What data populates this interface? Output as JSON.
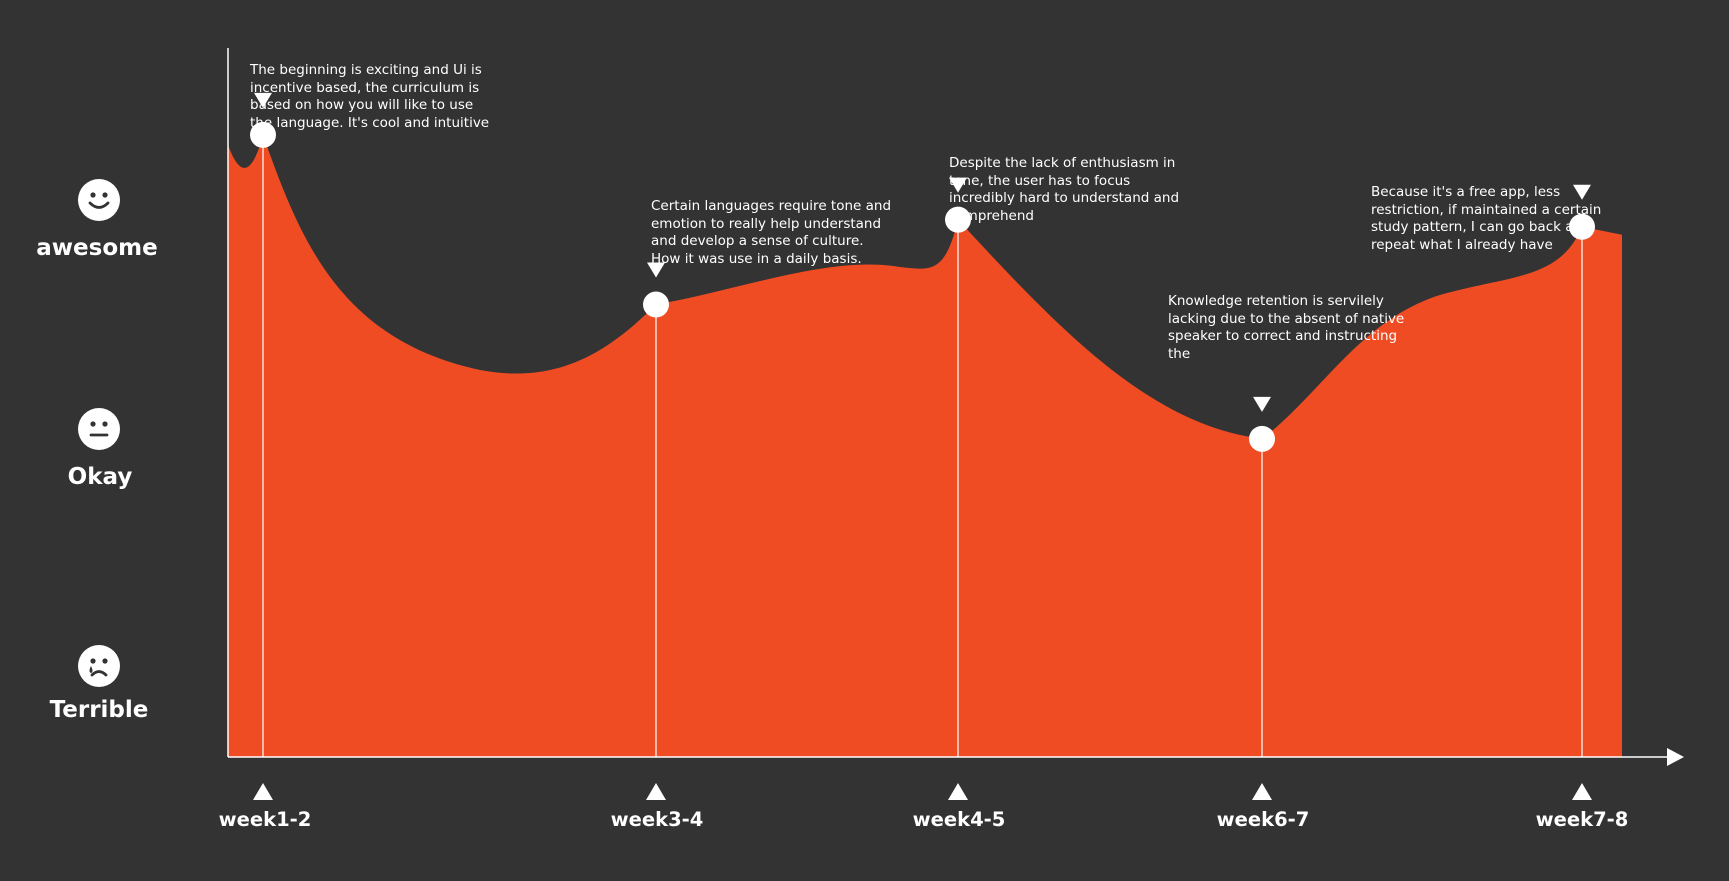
{
  "colors": {
    "background": "#333333",
    "area": "#F04C23",
    "foreground": "#FFFFFF"
  },
  "y_levels": [
    {
      "label": "awesome",
      "icon": "smile-face-icon"
    },
    {
      "label": "Okay",
      "icon": "neutral-face-icon"
    },
    {
      "label": "Terrible",
      "icon": "crying-face-icon"
    }
  ],
  "chart_data": {
    "type": "area",
    "categories": [
      "week1-2",
      "week3-4",
      "week4-5",
      "week6-7",
      "week7-8"
    ],
    "values": [
      88,
      64,
      76,
      45,
      75
    ],
    "ylim": [
      0,
      100
    ],
    "xlabel": "",
    "ylabel": "",
    "annotations": [
      "The beginning is exciting and Ui is incentive based, the curriculum is based on how you will like to use the language. It's cool and intuitive",
      "Certain languages require tone and emotion to really help understand and develop a sense of culture. How it was use in a daily basis.",
      "Despite the lack of enthusiasm in tone, the user has to focus incredibly hard to understand and comprehend",
      "Knowledge retention is servilely lacking due to the absent of native speaker to correct and instructing the",
      "Because it's a free app, less restriction, if maintained a certain study pattern, I can go back and repeat what I already have"
    ]
  }
}
